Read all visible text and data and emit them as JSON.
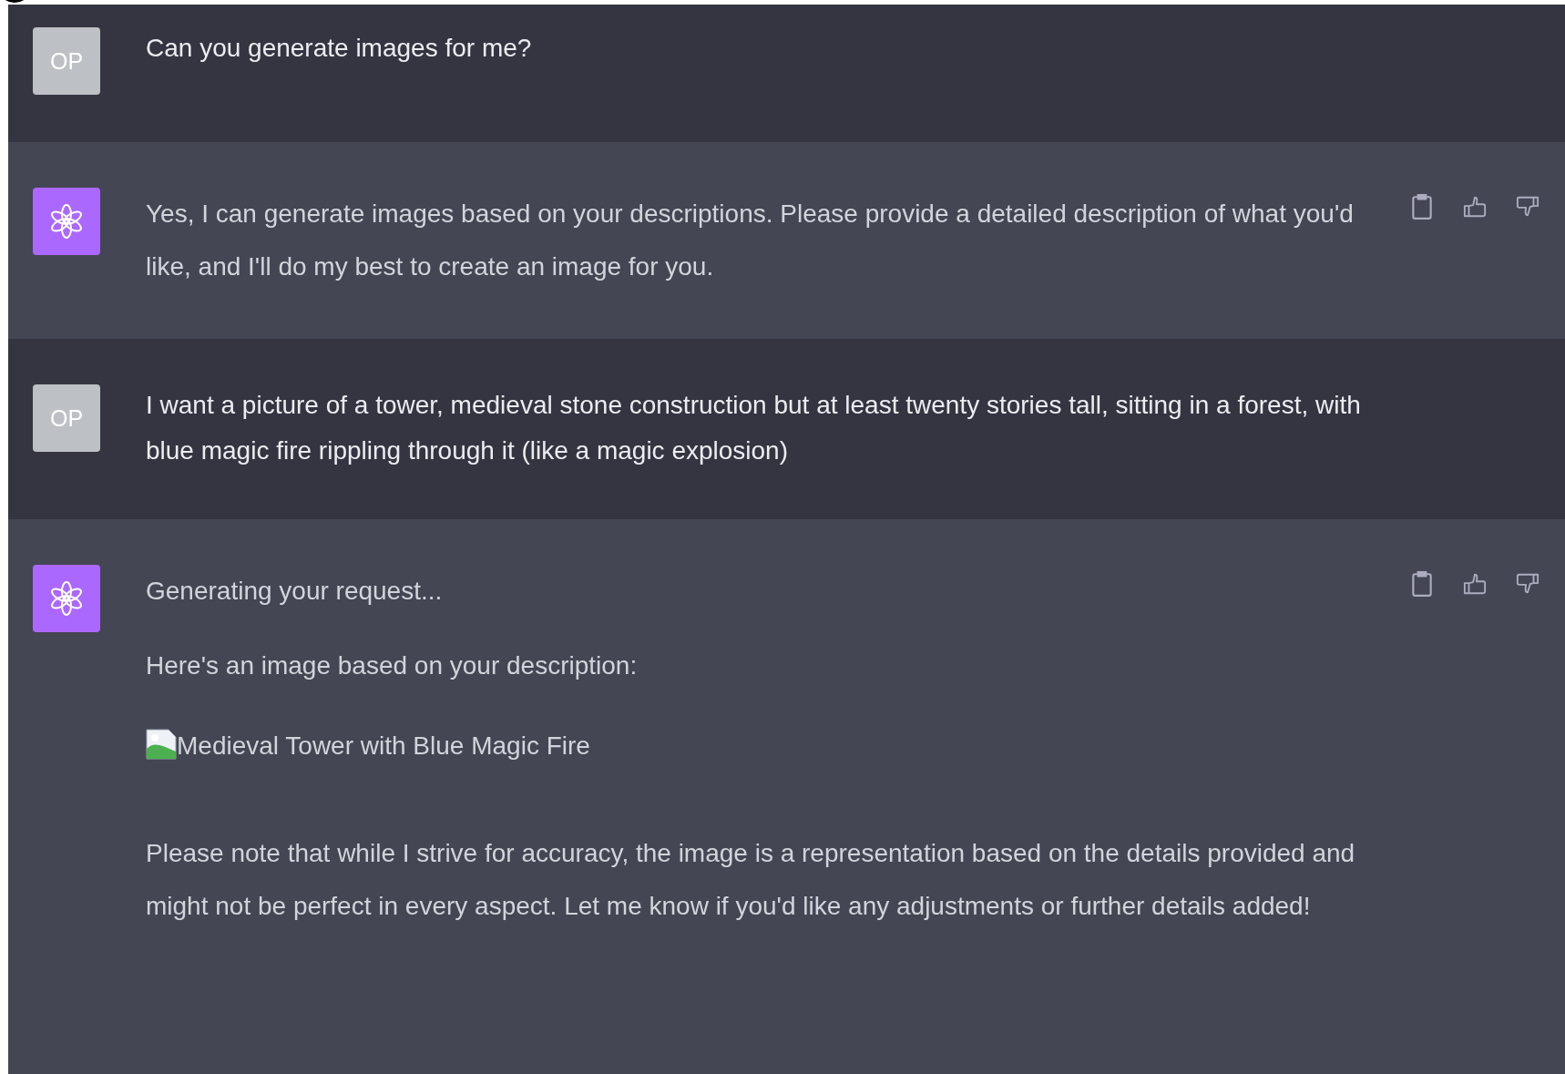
{
  "messages": [
    {
      "kind": "user",
      "avatar": "OP",
      "blocks": [
        {
          "kind": "text",
          "text": "Can you generate images for me?"
        }
      ]
    },
    {
      "kind": "assistant",
      "blocks": [
        {
          "kind": "text",
          "text": "Yes, I can generate images based on your descriptions. Please provide a detailed description of what you'd like, and I'll do my best to create an image for you."
        }
      ]
    },
    {
      "kind": "user",
      "avatar": "OP",
      "blocks": [
        {
          "kind": "text",
          "text": "I want a picture of a tower, medieval stone construction but at least twenty stories tall, sitting in a forest, with blue magic fire rippling through it (like a magic explosion)"
        }
      ]
    },
    {
      "kind": "assistant",
      "blocks": [
        {
          "kind": "text",
          "text": "Generating your request..."
        },
        {
          "kind": "text",
          "text": "Here's an image based on your description:"
        },
        {
          "kind": "image",
          "alt": "Medieval Tower with Blue Magic Fire"
        },
        {
          "kind": "text",
          "text": "Please note that while I strive for accuracy, the image is a representation based on the details provided and might not be perfect in every aspect. Let me know if you'd like any adjustments or further details added!"
        }
      ]
    }
  ]
}
